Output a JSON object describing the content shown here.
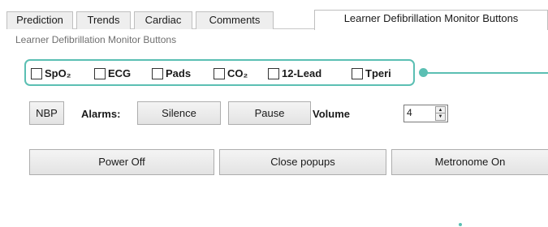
{
  "tabs": [
    {
      "label": "Prediction",
      "active": false
    },
    {
      "label": "Trends",
      "active": false
    },
    {
      "label": "Cardiac",
      "active": false
    },
    {
      "label": "Comments",
      "active": false
    },
    {
      "label": "Learner Defibrillation Monitor Buttons",
      "active": true
    }
  ],
  "page": {
    "subtitle": "Learner Defibrillation Monitor Buttons"
  },
  "checkboxes": [
    {
      "label": "SpO₂",
      "checked": false
    },
    {
      "label": "ECG",
      "checked": false
    },
    {
      "label": "Pads",
      "checked": false
    },
    {
      "label": "CO₂",
      "checked": false
    },
    {
      "label": "12-Lead",
      "checked": false
    },
    {
      "label": "Tperi",
      "checked": false
    }
  ],
  "controls": {
    "nbp_label": "NBP",
    "alarms_label": "Alarms:",
    "silence_label": "Silence",
    "pause_label": "Pause",
    "volume_label": "Volume",
    "volume_value": "4"
  },
  "actions": {
    "power_off_label": "Power Off",
    "close_popups_label": "Close popups",
    "metronome_label": "Metronome On"
  },
  "colors": {
    "accent": "#5bbfb3"
  }
}
